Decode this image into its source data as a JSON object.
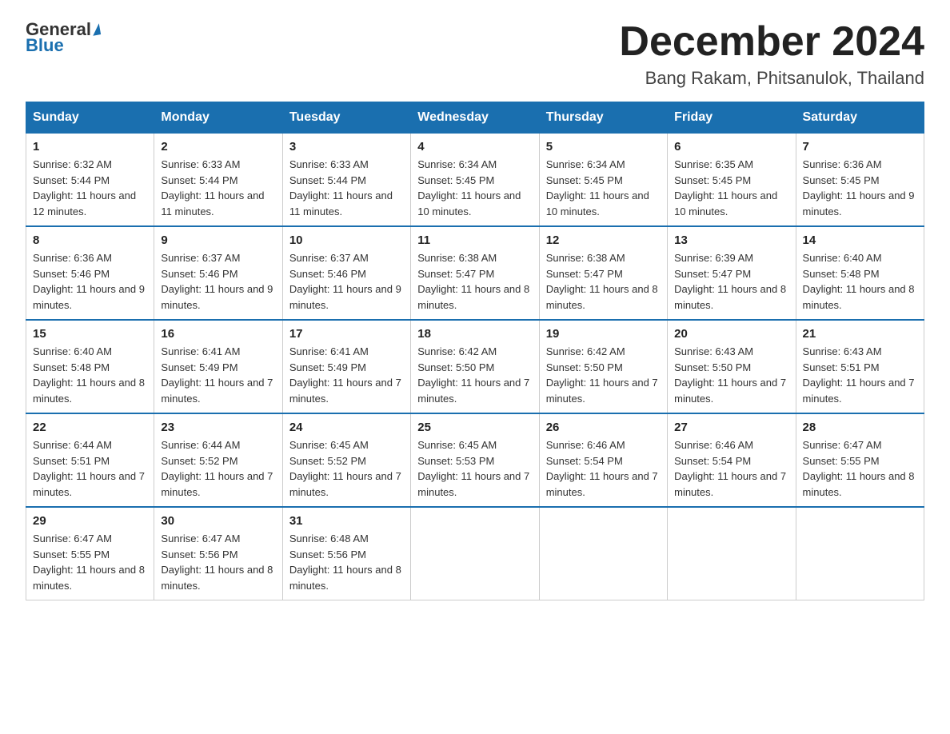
{
  "logo": {
    "general": "General",
    "blue": "Blue"
  },
  "header": {
    "title": "December 2024",
    "subtitle": "Bang Rakam, Phitsanulok, Thailand"
  },
  "days_of_week": [
    "Sunday",
    "Monday",
    "Tuesday",
    "Wednesday",
    "Thursday",
    "Friday",
    "Saturday"
  ],
  "weeks": [
    [
      {
        "day": "1",
        "sunrise": "6:32 AM",
        "sunset": "5:44 PM",
        "daylight": "11 hours and 12 minutes."
      },
      {
        "day": "2",
        "sunrise": "6:33 AM",
        "sunset": "5:44 PM",
        "daylight": "11 hours and 11 minutes."
      },
      {
        "day": "3",
        "sunrise": "6:33 AM",
        "sunset": "5:44 PM",
        "daylight": "11 hours and 11 minutes."
      },
      {
        "day": "4",
        "sunrise": "6:34 AM",
        "sunset": "5:45 PM",
        "daylight": "11 hours and 10 minutes."
      },
      {
        "day": "5",
        "sunrise": "6:34 AM",
        "sunset": "5:45 PM",
        "daylight": "11 hours and 10 minutes."
      },
      {
        "day": "6",
        "sunrise": "6:35 AM",
        "sunset": "5:45 PM",
        "daylight": "11 hours and 10 minutes."
      },
      {
        "day": "7",
        "sunrise": "6:36 AM",
        "sunset": "5:45 PM",
        "daylight": "11 hours and 9 minutes."
      }
    ],
    [
      {
        "day": "8",
        "sunrise": "6:36 AM",
        "sunset": "5:46 PM",
        "daylight": "11 hours and 9 minutes."
      },
      {
        "day": "9",
        "sunrise": "6:37 AM",
        "sunset": "5:46 PM",
        "daylight": "11 hours and 9 minutes."
      },
      {
        "day": "10",
        "sunrise": "6:37 AM",
        "sunset": "5:46 PM",
        "daylight": "11 hours and 9 minutes."
      },
      {
        "day": "11",
        "sunrise": "6:38 AM",
        "sunset": "5:47 PM",
        "daylight": "11 hours and 8 minutes."
      },
      {
        "day": "12",
        "sunrise": "6:38 AM",
        "sunset": "5:47 PM",
        "daylight": "11 hours and 8 minutes."
      },
      {
        "day": "13",
        "sunrise": "6:39 AM",
        "sunset": "5:47 PM",
        "daylight": "11 hours and 8 minutes."
      },
      {
        "day": "14",
        "sunrise": "6:40 AM",
        "sunset": "5:48 PM",
        "daylight": "11 hours and 8 minutes."
      }
    ],
    [
      {
        "day": "15",
        "sunrise": "6:40 AM",
        "sunset": "5:48 PM",
        "daylight": "11 hours and 8 minutes."
      },
      {
        "day": "16",
        "sunrise": "6:41 AM",
        "sunset": "5:49 PM",
        "daylight": "11 hours and 7 minutes."
      },
      {
        "day": "17",
        "sunrise": "6:41 AM",
        "sunset": "5:49 PM",
        "daylight": "11 hours and 7 minutes."
      },
      {
        "day": "18",
        "sunrise": "6:42 AM",
        "sunset": "5:50 PM",
        "daylight": "11 hours and 7 minutes."
      },
      {
        "day": "19",
        "sunrise": "6:42 AM",
        "sunset": "5:50 PM",
        "daylight": "11 hours and 7 minutes."
      },
      {
        "day": "20",
        "sunrise": "6:43 AM",
        "sunset": "5:50 PM",
        "daylight": "11 hours and 7 minutes."
      },
      {
        "day": "21",
        "sunrise": "6:43 AM",
        "sunset": "5:51 PM",
        "daylight": "11 hours and 7 minutes."
      }
    ],
    [
      {
        "day": "22",
        "sunrise": "6:44 AM",
        "sunset": "5:51 PM",
        "daylight": "11 hours and 7 minutes."
      },
      {
        "day": "23",
        "sunrise": "6:44 AM",
        "sunset": "5:52 PM",
        "daylight": "11 hours and 7 minutes."
      },
      {
        "day": "24",
        "sunrise": "6:45 AM",
        "sunset": "5:52 PM",
        "daylight": "11 hours and 7 minutes."
      },
      {
        "day": "25",
        "sunrise": "6:45 AM",
        "sunset": "5:53 PM",
        "daylight": "11 hours and 7 minutes."
      },
      {
        "day": "26",
        "sunrise": "6:46 AM",
        "sunset": "5:54 PM",
        "daylight": "11 hours and 7 minutes."
      },
      {
        "day": "27",
        "sunrise": "6:46 AM",
        "sunset": "5:54 PM",
        "daylight": "11 hours and 7 minutes."
      },
      {
        "day": "28",
        "sunrise": "6:47 AM",
        "sunset": "5:55 PM",
        "daylight": "11 hours and 8 minutes."
      }
    ],
    [
      {
        "day": "29",
        "sunrise": "6:47 AM",
        "sunset": "5:55 PM",
        "daylight": "11 hours and 8 minutes."
      },
      {
        "day": "30",
        "sunrise": "6:47 AM",
        "sunset": "5:56 PM",
        "daylight": "11 hours and 8 minutes."
      },
      {
        "day": "31",
        "sunrise": "6:48 AM",
        "sunset": "5:56 PM",
        "daylight": "11 hours and 8 minutes."
      },
      null,
      null,
      null,
      null
    ]
  ]
}
